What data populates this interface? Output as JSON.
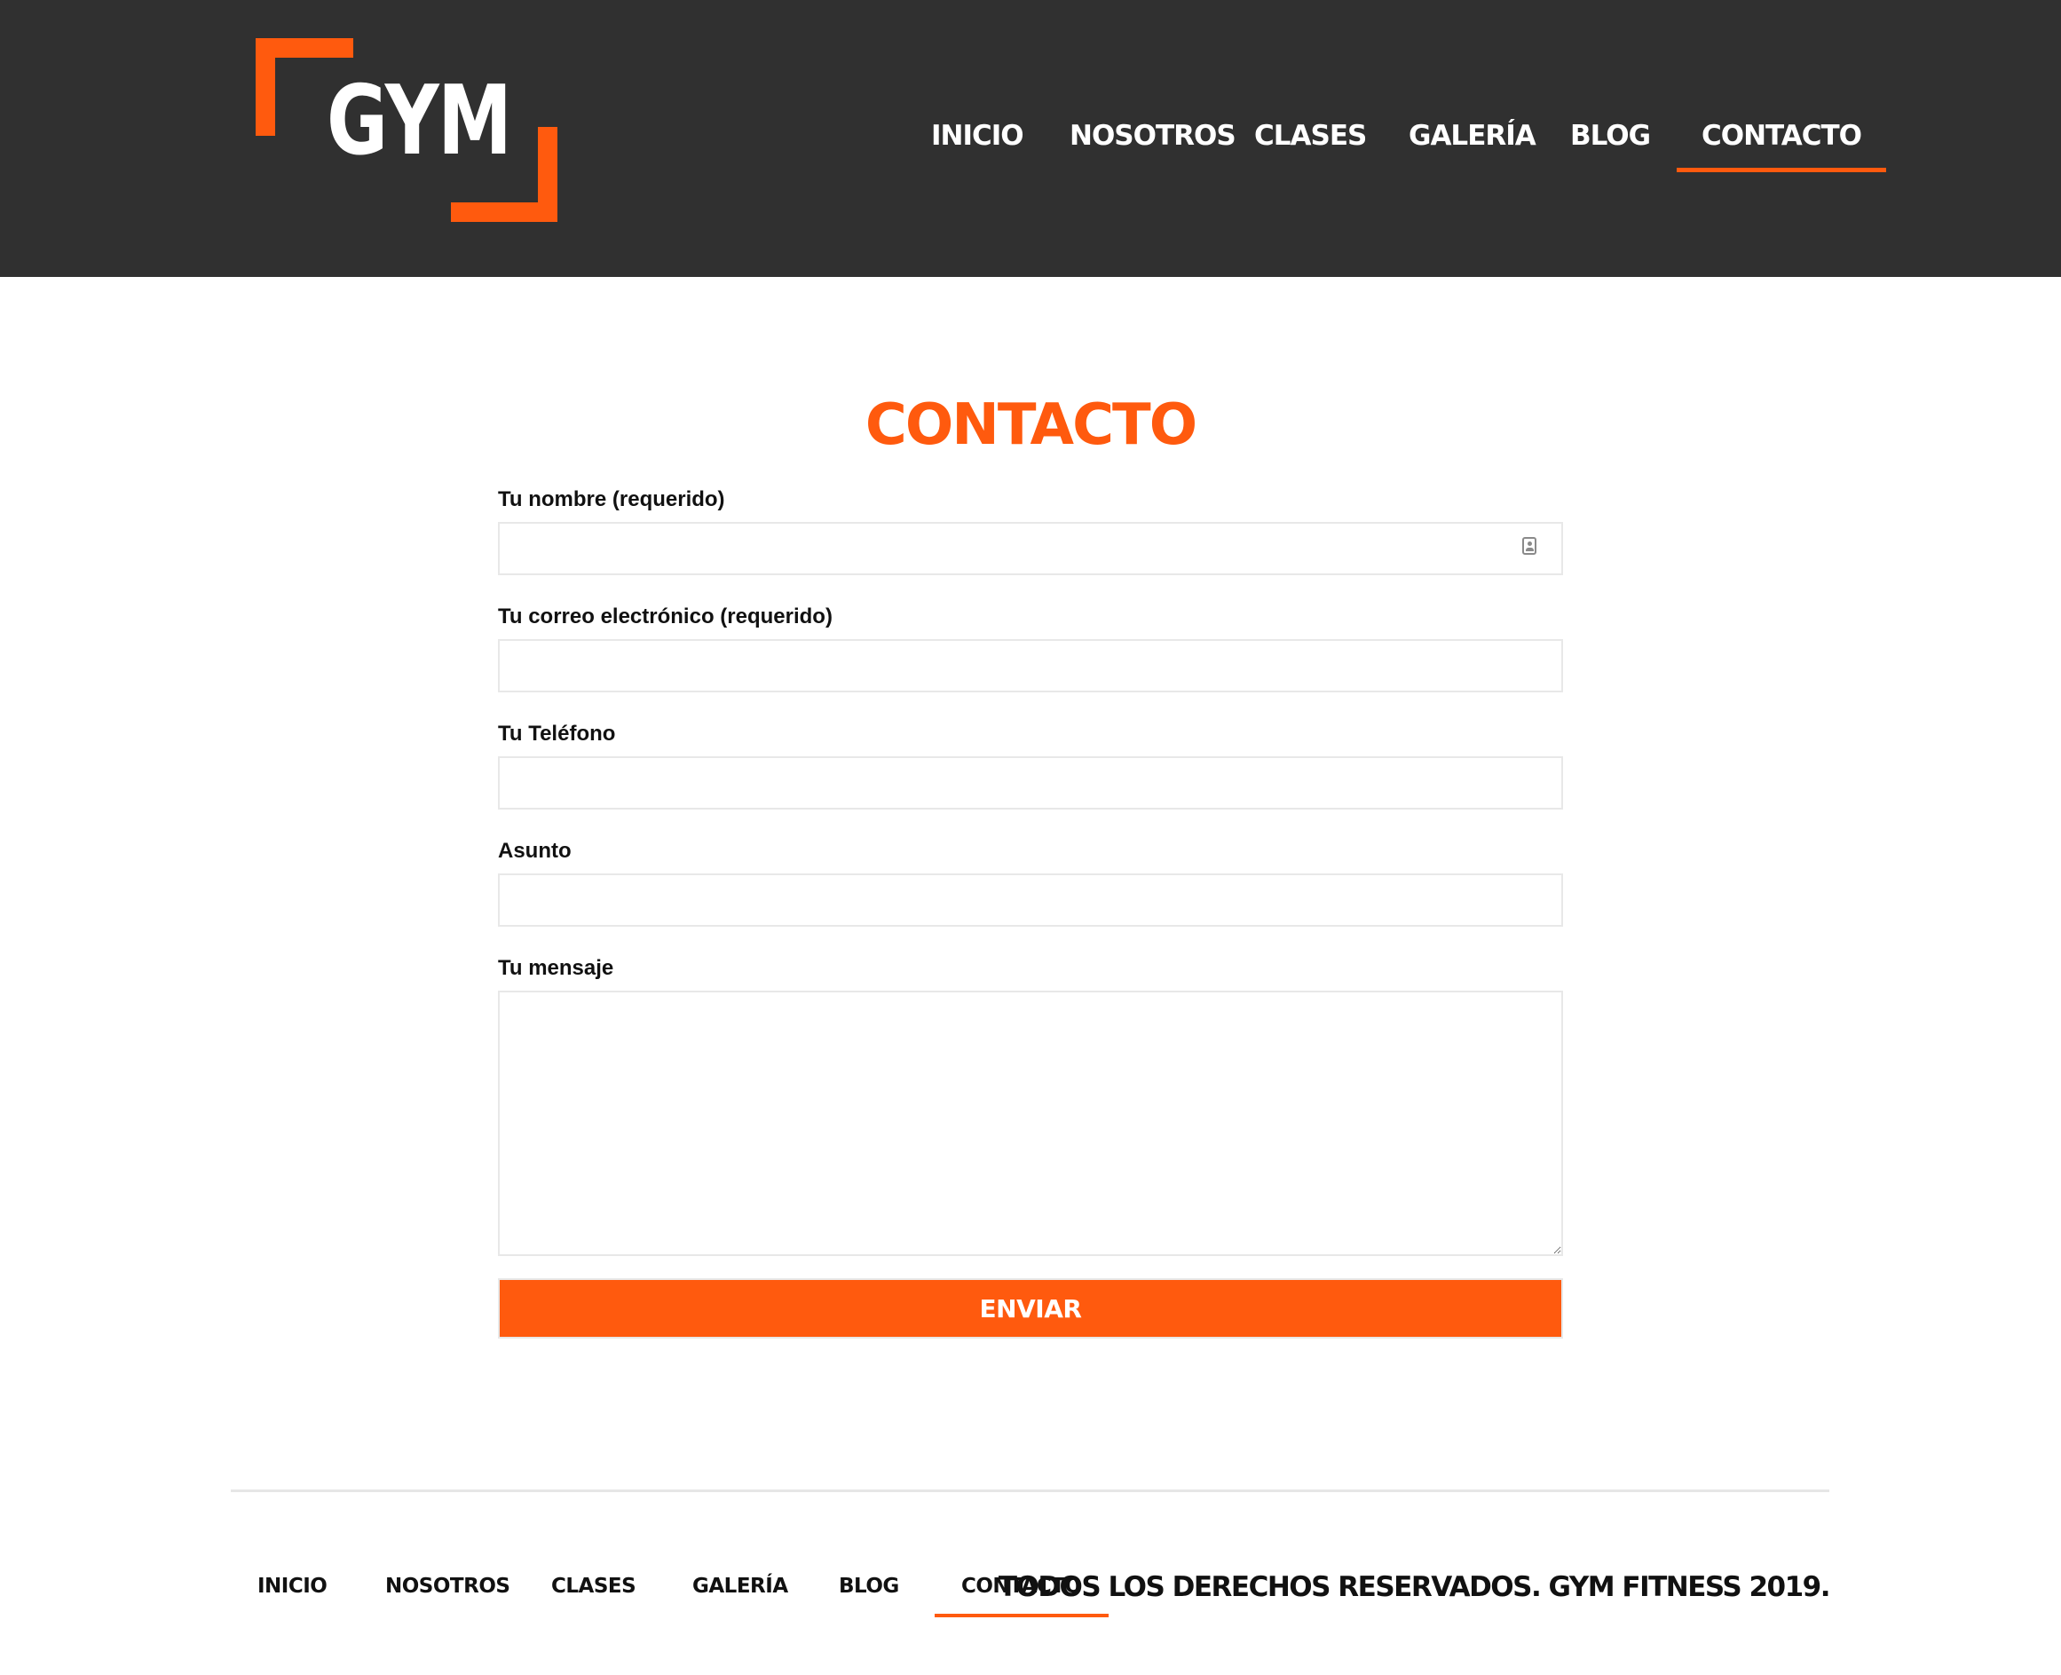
{
  "brand": {
    "logo_text": "GYM",
    "accent_color": "#ff5a0e",
    "header_bg": "#303030"
  },
  "header": {
    "nav": [
      {
        "label": "INICIO",
        "active": false
      },
      {
        "label": "NOSOTROS",
        "active": false
      },
      {
        "label": "CLASES",
        "active": false
      },
      {
        "label": "GALERÍA",
        "active": false
      },
      {
        "label": "BLOG",
        "active": false
      },
      {
        "label": "CONTACTO",
        "active": true
      }
    ]
  },
  "main": {
    "title": "CONTACTO",
    "form": {
      "name_label": "Tu nombre (requerido)",
      "name_value": "",
      "email_label": "Tu correo electrónico (requerido)",
      "email_value": "",
      "phone_label": "Tu Teléfono",
      "phone_value": "",
      "subject_label": "Asunto",
      "subject_value": "",
      "message_label": "Tu mensaje",
      "message_value": "",
      "submit_label": "ENVIAR",
      "autofill_icon": "contact-card-icon"
    }
  },
  "footer": {
    "nav": [
      {
        "label": "INICIO",
        "active": false
      },
      {
        "label": "NOSOTROS",
        "active": false
      },
      {
        "label": "CLASES",
        "active": false
      },
      {
        "label": "GALERÍA",
        "active": false
      },
      {
        "label": "BLOG",
        "active": false
      },
      {
        "label": "CONTACTO",
        "active": true
      }
    ],
    "copyright": "TODOS LOS DERECHOS RESERVADOS. GYM FITNESS 2019."
  }
}
